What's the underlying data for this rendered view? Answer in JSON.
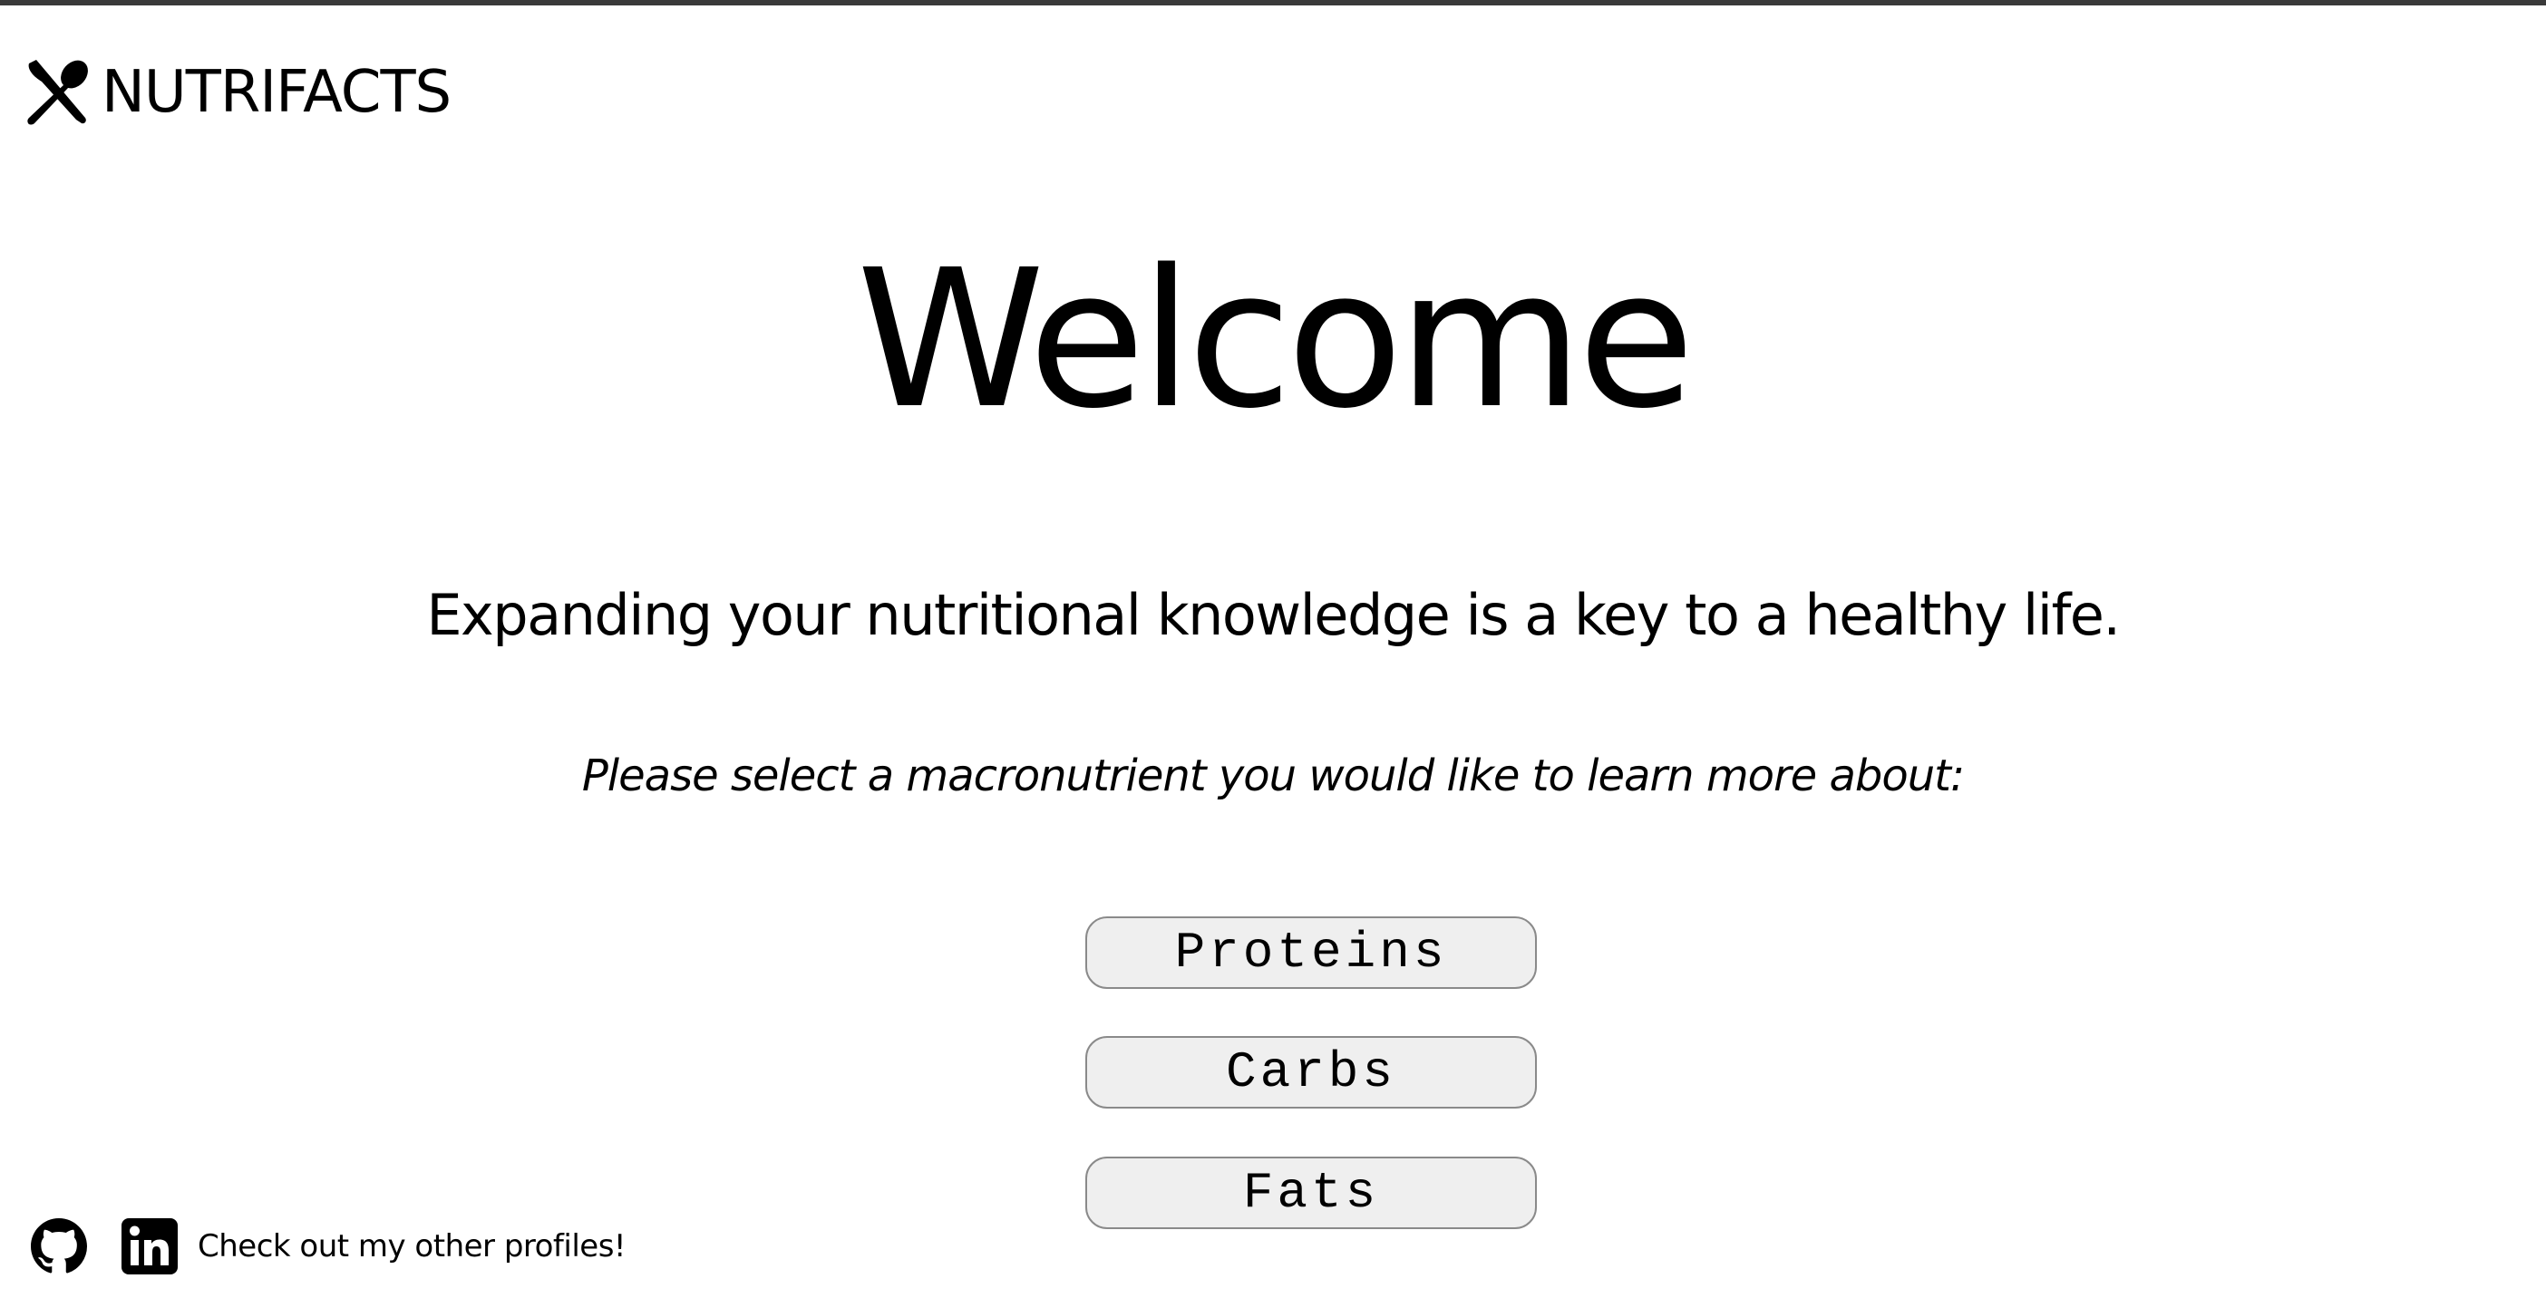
{
  "header": {
    "brand_name": "NUTRIFACTS",
    "brand_icon": "utensils-icon"
  },
  "main": {
    "title": "Welcome",
    "tagline": "Expanding your nutritional knowledge is a key to a healthy life.",
    "prompt": "Please select a macronutrient you would like to learn more about:",
    "buttons": [
      {
        "label": "Proteins"
      },
      {
        "label": "Carbs"
      },
      {
        "label": "Fats"
      }
    ]
  },
  "footer": {
    "github_icon": "github-icon",
    "linkedin_icon": "linkedin-icon",
    "text": "Check out my other profiles!"
  },
  "colors": {
    "text": "#000000",
    "background": "#ffffff",
    "button_bg": "#efefef",
    "button_border": "#8a8a8a",
    "top_rule": "#3a3a3a"
  }
}
